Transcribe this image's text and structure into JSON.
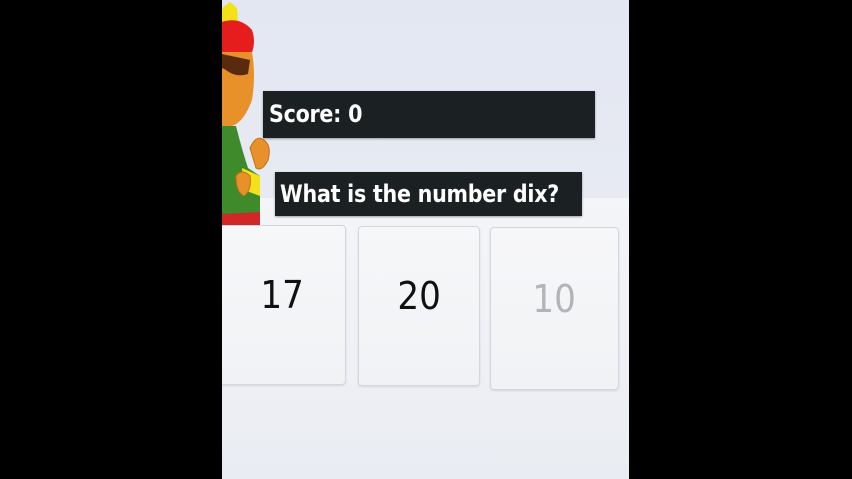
{
  "score": {
    "label": "Score: 0"
  },
  "question": {
    "text": "What is the number dix?"
  },
  "answers": [
    {
      "value": "17"
    },
    {
      "value": "20"
    },
    {
      "value": "10"
    }
  ],
  "colors": {
    "banner": "#1b2122",
    "banner_text": "#ffffff",
    "answer_text": "#111111",
    "answer_faded_text": "#b2b4b8"
  }
}
